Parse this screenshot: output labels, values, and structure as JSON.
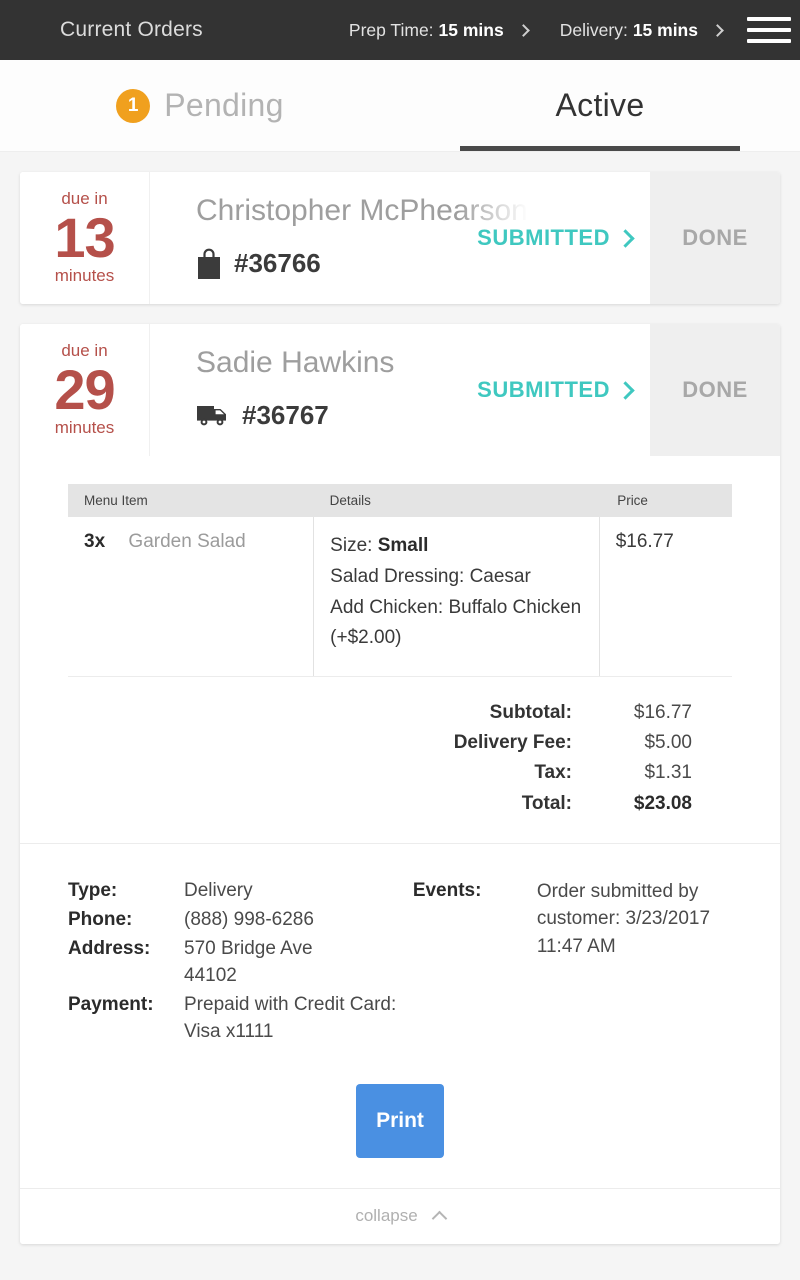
{
  "topbar": {
    "title": "Current Orders",
    "prep_label": "Prep Time:",
    "prep_value": "15 mins",
    "delivery_label": "Delivery:",
    "delivery_value": "15 mins",
    "menu_icon": "hamburger-menu-icon"
  },
  "tabs": [
    {
      "label": "Pending",
      "badge": "1",
      "active": false
    },
    {
      "label": "Active",
      "badge": "",
      "active": true
    }
  ],
  "orders": [
    {
      "due_prefix": "due in",
      "due_number": "13",
      "due_suffix": "minutes",
      "customer": "Christopher McPhearson",
      "order_id": "#36766",
      "type_icon": "shopping-bag-icon",
      "status": "SUBMITTED",
      "done": "DONE",
      "expanded": false
    },
    {
      "due_prefix": "due in",
      "due_number": "29",
      "due_suffix": "minutes",
      "customer": "Sadie Hawkins",
      "order_id": "#36767",
      "type_icon": "delivery-truck-icon",
      "status": "SUBMITTED",
      "done": "DONE",
      "expanded": true
    }
  ],
  "detail": {
    "table_headers": {
      "menu_item": "Menu Item",
      "details": "Details",
      "price": "Price"
    },
    "items": [
      {
        "qty": "3x",
        "name": "Garden Salad",
        "details": [
          {
            "label": "Size: ",
            "value": "Small",
            "bold_value": true
          },
          {
            "label": "Salad Dressing: Caesar",
            "value": "",
            "bold_value": false
          },
          {
            "label": "Add Chicken: Buffalo Chicken (+$2.00)",
            "value": "",
            "bold_value": false
          }
        ],
        "price": "$16.77"
      }
    ],
    "totals": [
      {
        "label": "Subtotal:",
        "value": "$16.77",
        "grand": false
      },
      {
        "label": "Delivery Fee:",
        "value": "$5.00",
        "grand": false
      },
      {
        "label": "Tax:",
        "value": "$1.31",
        "grand": false
      },
      {
        "label": "Total:",
        "value": "$23.08",
        "grand": true
      }
    ],
    "meta_left": [
      {
        "label": "Type:",
        "value": "Delivery"
      },
      {
        "label": "Phone:",
        "value": "(888) 998-6286"
      },
      {
        "label": "Address:",
        "value": "570 Bridge Ave\n44102"
      },
      {
        "label": "Payment:",
        "value": "Prepaid with Credit Card:\nVisa x1111"
      }
    ],
    "meta_right": [
      {
        "label": "Events:",
        "value": "Order submitted by customer: 3/23/2017 11:47 AM"
      }
    ],
    "print_label": "Print",
    "collapse_label": "collapse"
  },
  "colors": {
    "topbar_bg": "#333333",
    "timer_red": "#b5504a",
    "status_teal": "#3fc8c0",
    "badge_orange": "#f0a01e",
    "print_blue": "#4a90e2",
    "done_bg": "#efefef",
    "page_bg": "#f5f5f5"
  }
}
